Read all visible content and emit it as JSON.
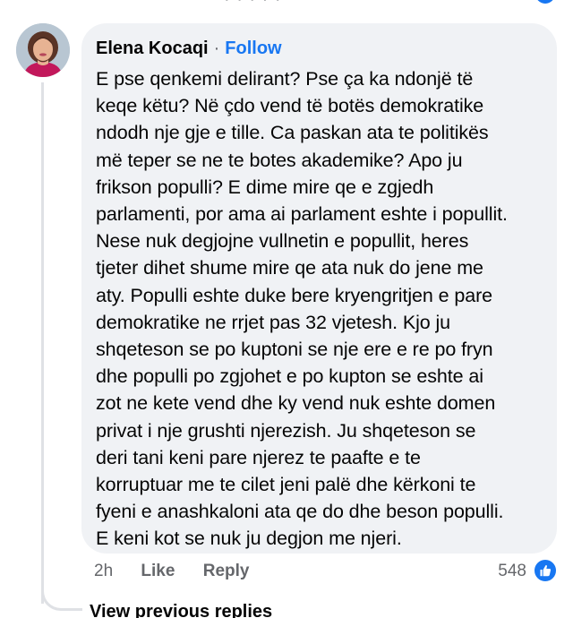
{
  "top_fragment": {
    "text": "· · · · ·"
  },
  "comment": {
    "author": "Elena Kocaqi",
    "separator": "·",
    "follow_label": "Follow",
    "lines": [
      "E pse qenkemi delirant? Pse ça ka ndonjë të",
      "keqe këtu? Në çdo vend të botës demokratike",
      "ndodh nje gje e tille. Ca paskan ata te politikës",
      "më teper se ne te botes akademike? Apo ju",
      "frikson populli? E dime mire qe e zgjedh",
      "parlamenti, por ama ai parlament eshte i popullit.",
      "Nese nuk degjojne vullnetin e popullit, heres",
      "tjeter dihet shume mire qe ata nuk do jene me",
      "aty. Populli eshte duke bere kryengritjen e pare",
      "demokratike ne rrjet pas 32 vjetesh. Kjo ju",
      "shqeteson se po kuptoni se nje ere e re po fryn",
      "dhe populli po zgjohet e po kupton se eshte ai",
      "zot ne kete vend dhe ky vend nuk eshte domen",
      "privat i nje grushti njerezish. Ju shqeteson se",
      "deri tani keni pare njerez te paafte e te",
      "korruptuar me te cilet jeni palë dhe kërkoni te",
      "fyeni e anashkaloni ata qe do dhe beson populli.",
      "E keni kot se nuk ju degjon me njeri."
    ],
    "timestamp": "2h",
    "like_label": "Like",
    "reply_label": "Reply",
    "reaction_count": "548"
  },
  "view_previous_replies_label": "View previous replies",
  "colors": {
    "accent": "#1877f2",
    "bubble": "#f0f2f5",
    "secondary_text": "#65676b"
  },
  "icons": {
    "reaction": "thumbs-up-icon"
  }
}
